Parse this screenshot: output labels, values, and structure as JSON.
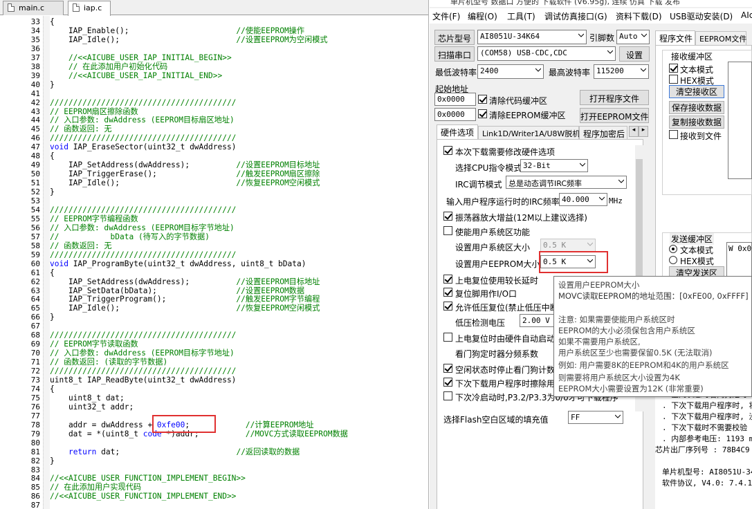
{
  "editor": {
    "tabs": [
      {
        "label": "main.c"
      },
      {
        "label": "iap.c"
      }
    ],
    "lines": [
      {
        "n": "33",
        "code": [
          {
            "t": "{",
            "c": ""
          }
        ]
      },
      {
        "n": "34",
        "code": [
          {
            "t": "    IAP_Enable();                       ",
            "c": ""
          },
          {
            "t": "//使能EEPROM操作",
            "c": "cm"
          }
        ]
      },
      {
        "n": "35",
        "code": [
          {
            "t": "    IAP_Idle();                         ",
            "c": ""
          },
          {
            "t": "//设置EEPROM为空闲模式",
            "c": "cm"
          }
        ]
      },
      {
        "n": "36",
        "code": []
      },
      {
        "n": "37",
        "code": [
          {
            "t": "    //<<AICUBE_USER_IAP_INITIAL_BEGIN>>",
            "c": "cm"
          }
        ]
      },
      {
        "n": "38",
        "code": [
          {
            "t": "    // 在此添加用户初始化代码",
            "c": "cm"
          }
        ]
      },
      {
        "n": "39",
        "code": [
          {
            "t": "    //<<AICUBE_USER_IAP_INITIAL_END>>",
            "c": "cm"
          }
        ]
      },
      {
        "n": "40",
        "code": [
          {
            "t": "}",
            "c": ""
          }
        ]
      },
      {
        "n": "41",
        "code": []
      },
      {
        "n": "42",
        "code": [
          {
            "t": "////////////////////////////////////////",
            "c": "cm"
          }
        ]
      },
      {
        "n": "43",
        "code": [
          {
            "t": "// EEPROM扇区擦除函数",
            "c": "cm"
          }
        ]
      },
      {
        "n": "44",
        "code": [
          {
            "t": "// 入口参数: dwAddress (EEPROM目标扇区地址)",
            "c": "cm"
          }
        ]
      },
      {
        "n": "45",
        "code": [
          {
            "t": "// 函数返回: 无",
            "c": "cm"
          }
        ]
      },
      {
        "n": "46",
        "code": [
          {
            "t": "////////////////////////////////////////",
            "c": "cm"
          }
        ]
      },
      {
        "n": "47",
        "code": [
          {
            "t": "void",
            "c": "kw"
          },
          {
            "t": " IAP_EraseSector(uint32_t dwAddress)",
            "c": ""
          }
        ]
      },
      {
        "n": "48",
        "code": [
          {
            "t": "{",
            "c": ""
          }
        ]
      },
      {
        "n": "49",
        "code": [
          {
            "t": "    IAP_SetAddress(dwAddress);          ",
            "c": ""
          },
          {
            "t": "//设置EEPROM目标地址",
            "c": "cm"
          }
        ]
      },
      {
        "n": "50",
        "code": [
          {
            "t": "    IAP_TriggerErase();                 ",
            "c": ""
          },
          {
            "t": "//触发EEPROM扇区擦除",
            "c": "cm"
          }
        ]
      },
      {
        "n": "51",
        "code": [
          {
            "t": "    IAP_Idle();                         ",
            "c": ""
          },
          {
            "t": "//恢复EEPROM空闲模式",
            "c": "cm"
          }
        ]
      },
      {
        "n": "52",
        "code": [
          {
            "t": "}",
            "c": ""
          }
        ]
      },
      {
        "n": "53",
        "code": []
      },
      {
        "n": "54",
        "code": [
          {
            "t": "////////////////////////////////////////",
            "c": "cm"
          }
        ]
      },
      {
        "n": "55",
        "code": [
          {
            "t": "// EEPROM字节编程函数",
            "c": "cm"
          }
        ]
      },
      {
        "n": "56",
        "code": [
          {
            "t": "// 入口参数: dwAddress (EEPROM目标字节地址)",
            "c": "cm"
          }
        ]
      },
      {
        "n": "57",
        "code": [
          {
            "t": "//           bData (待写入的字节数据)",
            "c": "cm"
          }
        ]
      },
      {
        "n": "58",
        "code": [
          {
            "t": "// 函数返回: 无",
            "c": "cm"
          }
        ]
      },
      {
        "n": "59",
        "code": [
          {
            "t": "////////////////////////////////////////",
            "c": "cm"
          }
        ]
      },
      {
        "n": "60",
        "code": [
          {
            "t": "void",
            "c": "kw"
          },
          {
            "t": " IAP_ProgramByte(uint32_t dwAddress, uint8_t bData)",
            "c": ""
          }
        ]
      },
      {
        "n": "61",
        "code": [
          {
            "t": "{",
            "c": ""
          }
        ]
      },
      {
        "n": "62",
        "code": [
          {
            "t": "    IAP_SetAddress(dwAddress);          ",
            "c": ""
          },
          {
            "t": "//设置EEPROM目标地址",
            "c": "cm"
          }
        ]
      },
      {
        "n": "63",
        "code": [
          {
            "t": "    IAP_SetData(bData);                 ",
            "c": ""
          },
          {
            "t": "//设置EEPROM数据",
            "c": "cm"
          }
        ]
      },
      {
        "n": "64",
        "code": [
          {
            "t": "    IAP_TriggerProgram();               ",
            "c": ""
          },
          {
            "t": "//触发EEPROM字节编程",
            "c": "cm"
          }
        ]
      },
      {
        "n": "65",
        "code": [
          {
            "t": "    IAP_Idle();                         ",
            "c": ""
          },
          {
            "t": "//恢复EEPROM空闲模式",
            "c": "cm"
          }
        ]
      },
      {
        "n": "66",
        "code": [
          {
            "t": "}",
            "c": ""
          }
        ]
      },
      {
        "n": "67",
        "code": []
      },
      {
        "n": "68",
        "code": [
          {
            "t": "////////////////////////////////////////",
            "c": "cm"
          }
        ]
      },
      {
        "n": "69",
        "code": [
          {
            "t": "// EEPROM字节读取函数",
            "c": "cm"
          }
        ]
      },
      {
        "n": "70",
        "code": [
          {
            "t": "// 入口参数: dwAddress (EEPROM目标字节地址)",
            "c": "cm"
          }
        ]
      },
      {
        "n": "71",
        "code": [
          {
            "t": "// 函数返回: (读取的字节数据)",
            "c": "cm"
          }
        ]
      },
      {
        "n": "72",
        "code": [
          {
            "t": "////////////////////////////////////////",
            "c": "cm"
          }
        ]
      },
      {
        "n": "73",
        "code": [
          {
            "t": "uint8_t IAP_ReadByte(uint32_t dwAddress)",
            "c": ""
          }
        ]
      },
      {
        "n": "74",
        "code": [
          {
            "t": "{",
            "c": ""
          }
        ]
      },
      {
        "n": "75",
        "code": [
          {
            "t": "    uint8_t dat;",
            "c": ""
          }
        ]
      },
      {
        "n": "76",
        "code": [
          {
            "t": "    uint32_t addr;",
            "c": ""
          }
        ]
      },
      {
        "n": "77",
        "code": []
      },
      {
        "n": "78",
        "code": [
          {
            "t": "    addr = dwAddress + ",
            "c": ""
          },
          {
            "t": "0xfe00",
            "c": "hx"
          },
          {
            "t": ";            ",
            "c": ""
          },
          {
            "t": "//计算EEPROM地址",
            "c": "cm"
          }
        ]
      },
      {
        "n": "79",
        "code": [
          {
            "t": "    dat = *(uint8_t ",
            "c": ""
          },
          {
            "t": "code",
            "c": "kw"
          },
          {
            "t": " *)addr;          ",
            "c": ""
          },
          {
            "t": "//MOVC方式读取EEPROM数据",
            "c": "cm"
          }
        ]
      },
      {
        "n": "80",
        "code": []
      },
      {
        "n": "81",
        "code": [
          {
            "t": "    ",
            "c": ""
          },
          {
            "t": "return",
            "c": "kw"
          },
          {
            "t": " dat;                         ",
            "c": ""
          },
          {
            "t": "//返回读取的数据",
            "c": "cm"
          }
        ]
      },
      {
        "n": "82",
        "code": [
          {
            "t": "}",
            "c": ""
          }
        ]
      },
      {
        "n": "83",
        "code": []
      },
      {
        "n": "84",
        "code": [
          {
            "t": "//<<AICUBE_USER_FUNCTION_IMPLEMENT_BEGIN>>",
            "c": "cm"
          }
        ]
      },
      {
        "n": "85",
        "code": [
          {
            "t": "// 在此添加用户实现代码",
            "c": "cm"
          }
        ]
      },
      {
        "n": "86",
        "code": [
          {
            "t": "//<<AICUBE_USER_FUNCTION_IMPLEMENT_END>>",
            "c": "cm"
          }
        ]
      },
      {
        "n": "87",
        "code": []
      }
    ]
  },
  "isp": {
    "title": "单片机型号 数据口 方便的 下载软件 (V6.95g), 连续 仿真 下载 发布",
    "menu": [
      "文件(F)",
      "编程(O)",
      "工具(T)",
      "调试仿真接口(G)",
      "资料下载(D)",
      "USB驱动安装(D)",
      "AIc"
    ],
    "chip_label": "芯片型号",
    "chip_value": "AI8051U-34K64",
    "pin_label": "引脚数",
    "pin_value": "Auto",
    "scan_button": "扫描串口",
    "port_value": "(COM58) USB-CDC,CDC",
    "settings_button": "设置",
    "min_baud_label": "最低波特率",
    "min_baud_value": "2400",
    "max_baud_label": "最高波特率",
    "max_baud_value": "115200",
    "start_addr_label": "起始地址",
    "addr1": "0x0000",
    "clear_code_label": "清除代码缓冲区",
    "open_prog_button": "打开程序文件",
    "addr2": "0x0000",
    "clear_eeprom_label": "清除EEPROM缓冲区",
    "open_eeprom_button": "打开EEPROM文件",
    "tabs": [
      "硬件选项",
      "Link1D/Writer1A/U8W脱机",
      "程序加密后"
    ],
    "hw": {
      "modify_opts": "本次下载需要修改硬件选项",
      "cpu_mode_label": "选择CPU指令模式",
      "cpu_mode_value": "32-Bit",
      "irc_label": "IRC调节模式",
      "irc_value": "总是动态调节IRC频率",
      "freq_label": "输入用户程序运行时的IRC频率",
      "freq_value": "40.000",
      "freq_unit": "MHz",
      "osc_gain": "振荡器放大增益(12M以上建议选择)",
      "user_sys_area": "使能用户系统区功能",
      "sys_size_label": "设置用户系统区大小",
      "sys_size_value": "0.5 K",
      "eeprom_size_label": "设置用户EEPROM大小",
      "eeprom_size_value": "0.5 K",
      "long_delay": "上电复位使用较长延时",
      "reset_pin": "复位脚用作I/O口",
      "lvr": "允许低压复位(禁止低压中断",
      "lvd_label": "低压检测电压",
      "lvd_value": "2.00 V",
      "wdt_auto": "上电复位时由硬件自动启动",
      "wdt_div": "看门狗定时器分频系数",
      "idle_wdt": "空闲状态时停止看门狗计数",
      "erase_next": "下次下载用户程序时擦除用",
      "cold_boot": "下次冷启动时,P3.2/P3.3为0/0才可下载程序",
      "fill_label": "选择Flash空白区域的填充值",
      "fill_value": "FF"
    },
    "right_tabs": [
      "程序文件",
      "EEPROM文件"
    ],
    "recv": {
      "title": "接收缓冲区",
      "text_mode": "文本模式",
      "hex_mode": "HEX模式",
      "clear_btn": "清空接收区",
      "save_btn": "保存接收数据",
      "copy_btn": "复制接收数据",
      "to_file": "接收到文件"
    },
    "send": {
      "title": "发送缓冲区",
      "text_mode": "文本模式",
      "hex_mode": "HEX模式",
      "clear_btn": "清空发送区",
      "content": "W 0x0"
    },
    "info_lines": [
      ". 空闲状态时看门狗定时",
      ". 下次下载用户程序时, 将",
      ". 下次下载用户程序时, 没",
      ". 下次下载时不需要校验",
      ". 内部参考电压: 1193 m",
      "芯片出厂序列号 : 78B4C9",
      "",
      "单片机型号: AI8051U-34",
      "软件协议, V4.0: 7.4.1"
    ]
  },
  "tooltip": {
    "lines": [
      "设置用户EEPROM大小",
      "MOVC读取EEPROM的地址范围：[0xFE00, 0xFFFF]",
      "",
      "注意: 如果需要使能用户系统区时",
      "        EEPROM的大小必须保包含用户系统区",
      "        如果不需要用户系统区,",
      "        用户系统区至少也需要保留0.5K (无法取消)",
      "例如: 用户需要8K的EEPROM和4K的用户系统区",
      "        则需要将用户系统区大小设置为4K",
      "        EEPROM大小需要设置为12K (非常重要)"
    ]
  }
}
